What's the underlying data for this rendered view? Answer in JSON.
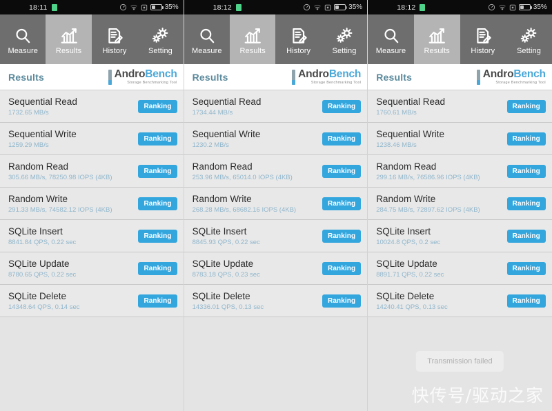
{
  "app": {
    "name": "AndroBench",
    "logo_main_dark": "Andro",
    "logo_main_blue": "Bench",
    "logo_tagline": "Storage Benchmarking Tool",
    "accent_color": "#33a6de",
    "value_color": "#8fb6cc",
    "tabbar_color": "#6e6e6e",
    "active_tab_color": "#b4b4b4"
  },
  "tabs": [
    {
      "label": "Measure",
      "icon": "search-icon",
      "active": false
    },
    {
      "label": "Results",
      "icon": "chart-icon",
      "active": true
    },
    {
      "label": "History",
      "icon": "document-icon",
      "active": false
    },
    {
      "label": "Setting",
      "icon": "gear-icon",
      "active": false
    }
  ],
  "header": {
    "title": "Results"
  },
  "row_labels": {
    "sequential_read": "Sequential Read",
    "sequential_write": "Sequential Write",
    "random_read": "Random Read",
    "random_write": "Random Write",
    "sqlite_insert": "SQLite Insert",
    "sqlite_update": "SQLite Update",
    "sqlite_delete": "SQLite Delete",
    "ranking_button": "Ranking"
  },
  "toast": {
    "text": "Transmission failed"
  },
  "watermark": {
    "text": "快传号/驱动之家"
  },
  "panels": [
    {
      "statusbar": {
        "time": "18:11",
        "battery": "35%"
      },
      "rows": [
        {
          "name": "Sequential Read",
          "value": "1732.65 MB/s",
          "button": "Ranking"
        },
        {
          "name": "Sequential Write",
          "value": "1259.29 MB/s",
          "button": "Ranking"
        },
        {
          "name": "Random Read",
          "value": "305.66 MB/s, 78250.98 IOPS (4KB)",
          "button": "Ranking"
        },
        {
          "name": "Random Write",
          "value": "291.33 MB/s, 74582.12 IOPS (4KB)",
          "button": "Ranking"
        },
        {
          "name": "SQLite Insert",
          "value": "8841.84 QPS, 0.22 sec",
          "button": "Ranking"
        },
        {
          "name": "SQLite Update",
          "value": "8780.65 QPS, 0.22 sec",
          "button": "Ranking"
        },
        {
          "name": "SQLite Delete",
          "value": "14348.64 QPS, 0.14 sec",
          "button": "Ranking"
        }
      ],
      "toast_visible": false
    },
    {
      "statusbar": {
        "time": "18:12",
        "battery": "35%"
      },
      "rows": [
        {
          "name": "Sequential Read",
          "value": "1734.44 MB/s",
          "button": "Ranking"
        },
        {
          "name": "Sequential Write",
          "value": "1230.2 MB/s",
          "button": "Ranking"
        },
        {
          "name": "Random Read",
          "value": "253.96 MB/s, 65014.0 IOPS (4KB)",
          "button": "Ranking"
        },
        {
          "name": "Random Write",
          "value": "268.28 MB/s, 68682.16 IOPS (4KB)",
          "button": "Ranking"
        },
        {
          "name": "SQLite Insert",
          "value": "8845.93 QPS, 0.22 sec",
          "button": "Ranking"
        },
        {
          "name": "SQLite Update",
          "value": "8783.18 QPS, 0.23 sec",
          "button": "Ranking"
        },
        {
          "name": "SQLite Delete",
          "value": "14336.01 QPS, 0.13 sec",
          "button": "Ranking"
        }
      ],
      "toast_visible": false
    },
    {
      "statusbar": {
        "time": "18:12",
        "battery": "35%"
      },
      "rows": [
        {
          "name": "Sequential Read",
          "value": "1760.61 MB/s",
          "button": "Ranking"
        },
        {
          "name": "Sequential Write",
          "value": "1238.46 MB/s",
          "button": "Ranking"
        },
        {
          "name": "Random Read",
          "value": "299.16 MB/s, 76586.96 IOPS (4KB)",
          "button": "Ranking"
        },
        {
          "name": "Random Write",
          "value": "284.75 MB/s, 72897.62 IOPS (4KB)",
          "button": "Ranking"
        },
        {
          "name": "SQLite Insert",
          "value": "10024.8 QPS, 0.2 sec",
          "button": "Ranking"
        },
        {
          "name": "SQLite Update",
          "value": "8891.71 QPS, 0.22 sec",
          "button": "Ranking"
        },
        {
          "name": "SQLite Delete",
          "value": "14240.41 QPS, 0.13 sec",
          "button": "Ranking"
        }
      ],
      "toast_visible": true
    }
  ]
}
